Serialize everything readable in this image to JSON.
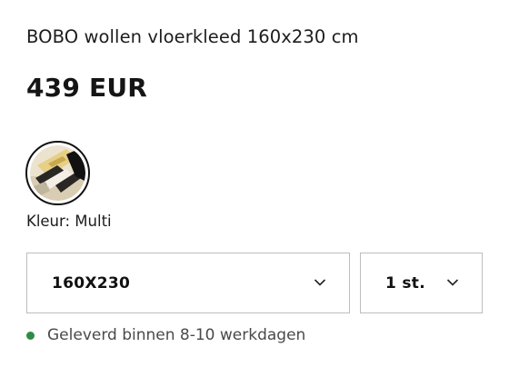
{
  "product": {
    "title": "BOBO wollen vloerkleed 160x230 cm",
    "price": "439 EUR"
  },
  "color": {
    "label": "Kleur: Multi",
    "swatch_icon": "rug-swatch-image"
  },
  "size_select": {
    "value": "160X230",
    "icon": "chevron-down-icon"
  },
  "quantity_select": {
    "value": "1 st.",
    "icon": "chevron-down-icon"
  },
  "delivery": {
    "text": "Geleverd binnen 8-10 werkdagen",
    "status_color": "#2f8a45"
  }
}
